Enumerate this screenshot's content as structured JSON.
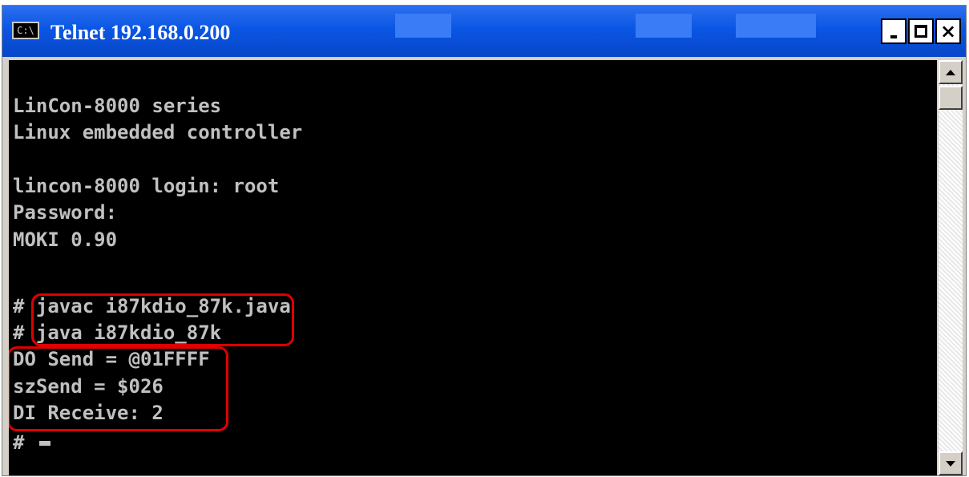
{
  "window": {
    "title": "Telnet 192.168.0.200",
    "icon_label": "C:\\",
    "controls": {
      "minimize": "_",
      "maximize": "□",
      "close": "×"
    }
  },
  "terminal": {
    "lines": [
      "",
      "LinCon-8000 series",
      "Linux embedded controller",
      "",
      "lincon-8000 login: root",
      "Password:",
      "MOKI 0.90",
      "",
      "# javac i87kdio_87k.java",
      "# java i87kdio_87k",
      "DO Send = @01FFFF",
      "szSend = $026",
      "DI Receive: 2",
      "# "
    ]
  },
  "colors": {
    "titlebar": "#0a56e4",
    "terminal_bg": "#000000",
    "terminal_fg": "#c0c0c0",
    "highlight": "#e00000"
  },
  "icons": {
    "app": "console-icon",
    "minimize": "minimize-icon",
    "maximize": "maximize-icon",
    "close": "close-icon",
    "scroll_up": "arrow-up-icon",
    "scroll_down": "arrow-down-icon"
  }
}
